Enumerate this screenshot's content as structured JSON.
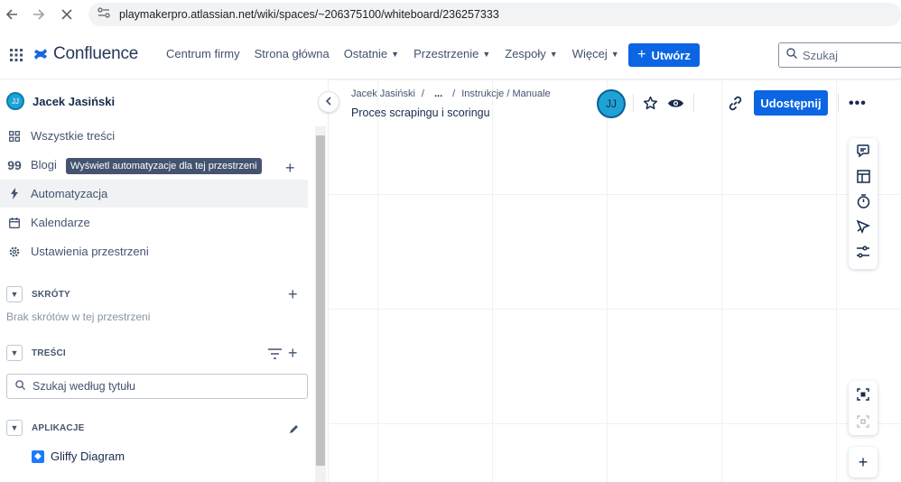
{
  "browser": {
    "url": "playmakerpro.atlassian.net/wiki/spaces/~206375100/whiteboard/236257333"
  },
  "header": {
    "product_name": "Confluence",
    "nav": [
      {
        "label": "Centrum firmy",
        "dropdown": false
      },
      {
        "label": "Strona główna",
        "dropdown": false
      },
      {
        "label": "Ostatnie",
        "dropdown": true
      },
      {
        "label": "Przestrzenie",
        "dropdown": true
      },
      {
        "label": "Zespoły",
        "dropdown": true
      },
      {
        "label": "Więcej",
        "dropdown": true
      }
    ],
    "create_label": "Utwórz",
    "search_placeholder": "Szukaj",
    "accent_color": "#0c66e4"
  },
  "sidebar": {
    "space_owner": "Jacek Jasiński",
    "avatar_initials": "JJ",
    "items": [
      {
        "label": "Wszystkie treści",
        "icon": "grid-icon"
      },
      {
        "label": "Blogi",
        "icon": "quote-icon"
      },
      {
        "label": "Automatyzacja",
        "icon": "lightning-icon"
      },
      {
        "label": "Kalendarze",
        "icon": "calendar-icon"
      },
      {
        "label": "Ustawienia przestrzeni",
        "icon": "gear-icon"
      }
    ],
    "tooltip": "Wyświetl automatyzacje dla tej przestrzeni",
    "shortcuts": {
      "label": "SKRÓTY",
      "empty_note": "Brak skrótów w tej przestrzeni"
    },
    "content": {
      "label": "TREŚCI",
      "search_placeholder": "Szukaj według tytułu"
    },
    "apps": {
      "label": "APLIKACJE",
      "items": [
        {
          "label": "Gliffy Diagram",
          "icon": "gliffy-icon"
        }
      ]
    }
  },
  "main": {
    "breadcrumb": [
      "Jacek Jasiński",
      "...",
      "Instrukcje / Manuale"
    ],
    "title": "Proces scrapingu i scoringu",
    "avatar_initials": "JJ",
    "share_label": "Udostępnij"
  }
}
